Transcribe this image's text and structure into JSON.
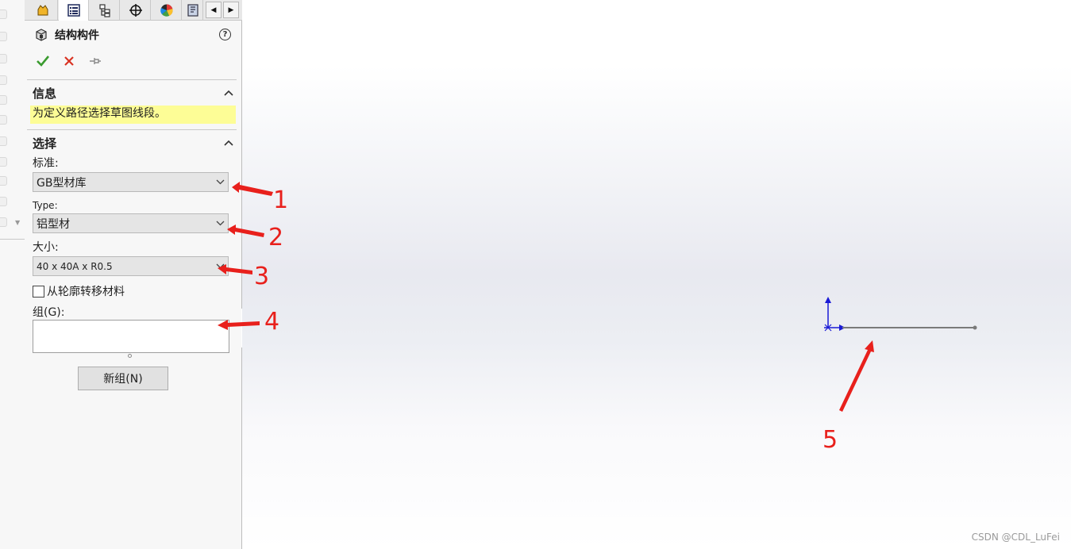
{
  "panel": {
    "title": "结构构件",
    "help_glyph": "?",
    "tabs": [
      "featuremanager-icon",
      "propertymanager-icon",
      "configurationmanager-icon",
      "dimxpert-icon",
      "display-manager-icon",
      "cam-icon"
    ],
    "nav_prev": "◀",
    "nav_next": "▶"
  },
  "message_group": {
    "title": "信息",
    "text": "为定义路径选择草图线段。"
  },
  "selection_group": {
    "title": "选择",
    "standard_label": "标准:",
    "standard_value": "GB型材库",
    "type_label": "Type:",
    "type_value": "铝型材",
    "size_label": "大小:",
    "size_value": "40 x 40A x R0.5",
    "transfer_checkbox_label": "从轮廓转移材料",
    "transfer_checked": false,
    "group_label": "组(G):",
    "new_group_button": "新组(N)"
  },
  "annotations": [
    "1",
    "2",
    "3",
    "4",
    "5"
  ],
  "watermark": "CSDN @CDL_LuFei",
  "colors": {
    "accept": "#3a9b2f",
    "cancel": "#d93323",
    "message_bg": "#fdfd96",
    "annotation": "#e8201c",
    "axis": "#1a1ad6",
    "sketch_line": "#7a7a7a"
  }
}
